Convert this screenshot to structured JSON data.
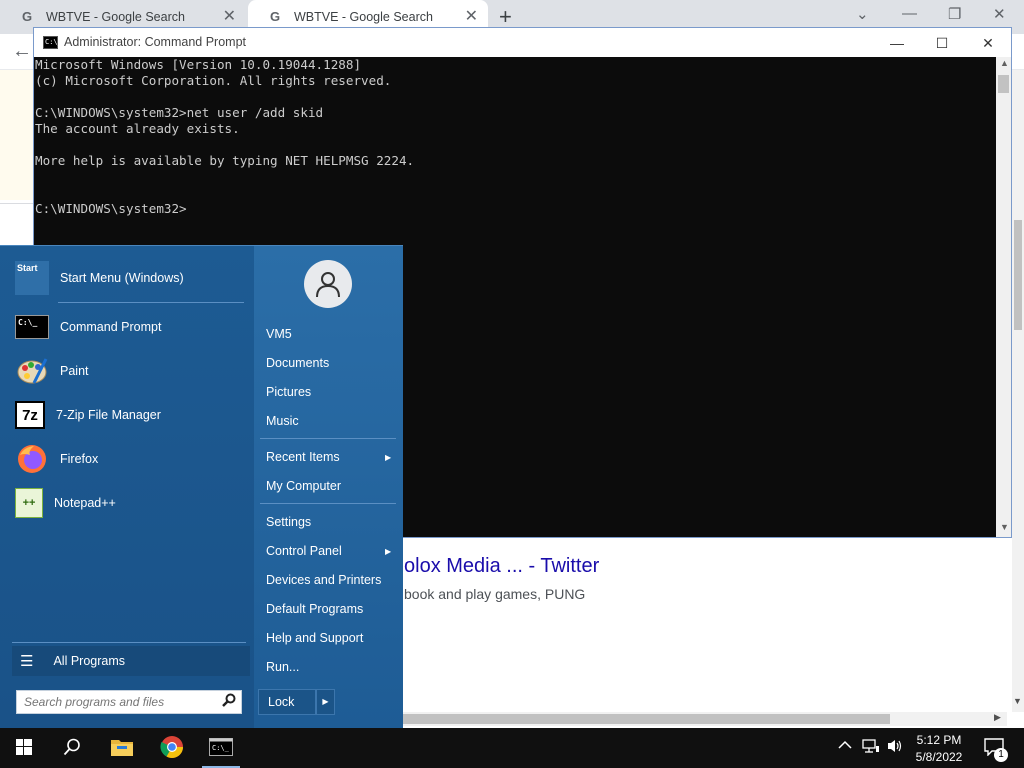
{
  "browser": {
    "tabs": [
      {
        "title": "WBTVE - Google Search",
        "close": "✕"
      },
      {
        "title": "WBTVE - Google Search",
        "close": "✕"
      }
    ],
    "new_tab": "+",
    "controls": {
      "tab_search": "⌄",
      "minimize": "—",
      "restore": "❐",
      "close": "✕"
    },
    "back": "←",
    "page": {
      "result_title": "olox Media ... - Twitter",
      "result_snippet": "book and play games, PUNG"
    }
  },
  "cmd": {
    "title": "Administrator: Command Prompt",
    "icon_text": "C:\\_",
    "controls": {
      "minimize": "—",
      "maximize": "☐",
      "close": "✕"
    },
    "lines": [
      "Microsoft Windows [Version 10.0.19044.1288]",
      "(c) Microsoft Corporation. All rights reserved.",
      "",
      "C:\\WINDOWS\\system32>net user /add skid",
      "The account already exists.",
      "",
      "More help is available by typing NET HELPMSG 2224.",
      "",
      "",
      "C:\\WINDOWS\\system32>"
    ]
  },
  "start_menu": {
    "pinned": [
      {
        "label": "Start Menu (Windows)",
        "icon": "start-menu-app-icon",
        "icon_text": "Start"
      },
      {
        "label": "Command Prompt",
        "icon": "command-prompt-icon",
        "icon_text": "C:\\_"
      },
      {
        "label": "Paint",
        "icon": "paint-palette-icon",
        "icon_text": "🎨"
      },
      {
        "label": "7-Zip File Manager",
        "icon": "7zip-icon",
        "icon_text": "7z"
      },
      {
        "label": "Firefox",
        "icon": "firefox-icon",
        "icon_text": ""
      },
      {
        "label": "Notepad++",
        "icon": "notepad-plus-plus-icon",
        "icon_text": "++"
      }
    ],
    "all_programs": "All Programs",
    "search_placeholder": "Search programs and files",
    "user": "VM5",
    "right_items": {
      "documents": "Documents",
      "pictures": "Pictures",
      "music": "Music",
      "recent_items": "Recent Items",
      "my_computer": "My Computer",
      "settings": "Settings",
      "control_panel": "Control Panel",
      "devices_printers": "Devices and Printers",
      "default_programs": "Default Programs",
      "help_support": "Help and Support",
      "run": "Run..."
    },
    "lock": "Lock"
  },
  "taskbar": {
    "time": "5:12 PM",
    "date": "5/8/2022",
    "notification_count": "1"
  },
  "colors": {
    "start_menu_blue": "#1e5c95",
    "console_bg": "#0c0c0c",
    "console_text": "#cccccc",
    "link_blue": "#1a0dab"
  }
}
